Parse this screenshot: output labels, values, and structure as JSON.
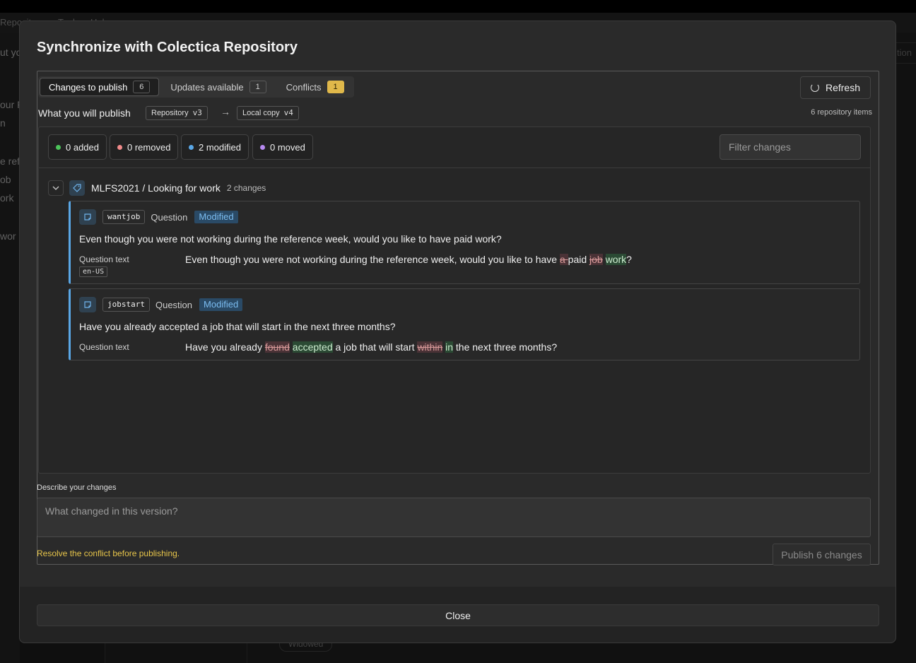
{
  "background": {
    "menu": [
      "Reposit",
      "Tools",
      "Help"
    ],
    "left_items": [
      "ut yo",
      "our F",
      "n",
      "e refe",
      "ob",
      "ork",
      "wor"
    ],
    "right_field": "tion",
    "bottom_chip": "Widowed"
  },
  "dialog": {
    "title": "Synchronize with Colectica Repository",
    "tabs": [
      {
        "label": "Changes to publish",
        "count": "6"
      },
      {
        "label": "Updates available",
        "count": "1"
      },
      {
        "label": "Conflicts",
        "count": "1"
      }
    ],
    "refresh_label": "Refresh",
    "publish_row": {
      "label": "What you will publish",
      "from_label": "Repository",
      "from_version": "v3",
      "to_label": "Local copy",
      "to_version": "v4",
      "items_count": "6 repository items"
    },
    "stats": [
      {
        "label": "0 added",
        "color": "#4cc45a"
      },
      {
        "label": "0 removed",
        "color": "#f08a8a"
      },
      {
        "label": "2 modified",
        "color": "#5aa7e6"
      },
      {
        "label": "0 moved",
        "color": "#b78af0"
      }
    ],
    "filter_placeholder": "Filter changes",
    "group": {
      "title": "MLFS2021 / Looking for work",
      "count": "2 changes"
    },
    "cards": [
      {
        "code": "wantjob",
        "kind": "Question",
        "badge": "Modified",
        "text": "Even though you were not working during the reference week, would you like to have paid work?",
        "diff_label": "Question text",
        "lang": "en-US",
        "diff": {
          "p1": "Even though you were not working during the reference week, would you like to have ",
          "del1": "a ",
          "p2": "paid ",
          "del2": "job",
          "p3": " ",
          "ins1": "work",
          "p4": "?"
        }
      },
      {
        "code": "jobstart",
        "kind": "Question",
        "badge": "Modified",
        "text": "Have you already accepted a job that will start in the next three months?",
        "diff_label": "Question text",
        "diff": {
          "p1": "Have you already ",
          "del1": "found",
          "p2": " ",
          "ins1": "accepted",
          "p3": " a job that will start ",
          "del2": "within",
          "p4": " ",
          "ins2": "in",
          "p5": " the next three months?"
        }
      }
    ],
    "describe_label": "Describe your changes",
    "describe_placeholder": "What changed in this version?",
    "warning": "Resolve the conflict before publishing.",
    "publish_label": "Publish 6 changes",
    "close_label": "Close"
  }
}
